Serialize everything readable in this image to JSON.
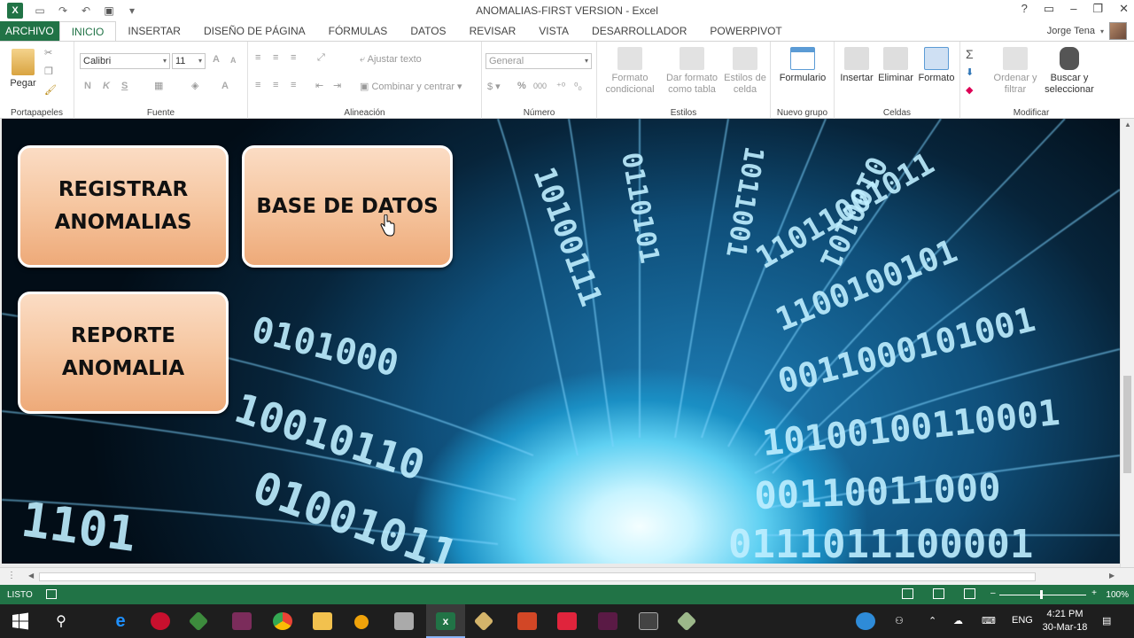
{
  "window": {
    "title": "ANOMALIAS-FIRST VERSION - Excel",
    "app_logo": "X",
    "controls": [
      "?",
      "▭",
      "–",
      "❐",
      "✕"
    ]
  },
  "ribbon_tabs": [
    "ARCHIVO",
    "INICIO",
    "INSERTAR",
    "DISEÑO DE PÁGINA",
    "FÓRMULAS",
    "DATOS",
    "REVISAR",
    "VISTA",
    "DESARROLLADOR",
    "POWERPIVOT"
  ],
  "user": {
    "name": "Jorge Tena"
  },
  "ribbon": {
    "clipboard": {
      "paste": "Pegar",
      "label": "Portapapeles"
    },
    "font": {
      "family": "Calibri",
      "size": "11",
      "grow": "A",
      "shrink": "A",
      "bold": "N",
      "italic": "K",
      "underline": "S",
      "color": "A",
      "label": "Fuente"
    },
    "alignment": {
      "wrap": "Ajustar texto",
      "merge": "Combinar y centrar",
      "label": "Alineación"
    },
    "number": {
      "format": "General",
      "percent": "%",
      "thousands": "000",
      "label": "Número"
    },
    "styles": {
      "conditional": "Formato condicional",
      "table": "Dar formato como tabla",
      "cell": "Estilos de celda",
      "label": "Estilos"
    },
    "new_group": {
      "form": "Formulario",
      "label": "Nuevo grupo"
    },
    "cells": {
      "insert": "Insertar",
      "delete": "Eliminar",
      "format": "Formato",
      "label": "Celdas"
    },
    "editing": {
      "sum": "Σ",
      "sort": "Ordenar y filtrar",
      "find": "Buscar y seleccionar",
      "label": "Modificar"
    }
  },
  "sheet_buttons": {
    "register": "REGISTRAR\nANOMALIAS",
    "database": "BASE DE DATOS",
    "report": "REPORTE\nANOMALIA"
  },
  "status_bar": {
    "ready": "LISTO",
    "zoom": "100%",
    "zoom_minus": "–",
    "zoom_plus": "+"
  },
  "taskbar": {
    "time": "4:21 PM",
    "date": "30-Mar-18",
    "lang": "ENG"
  },
  "colors": {
    "excel_green": "#217346",
    "button_fill": "#f6c8a3",
    "taskbar": "#1e1e1e"
  }
}
